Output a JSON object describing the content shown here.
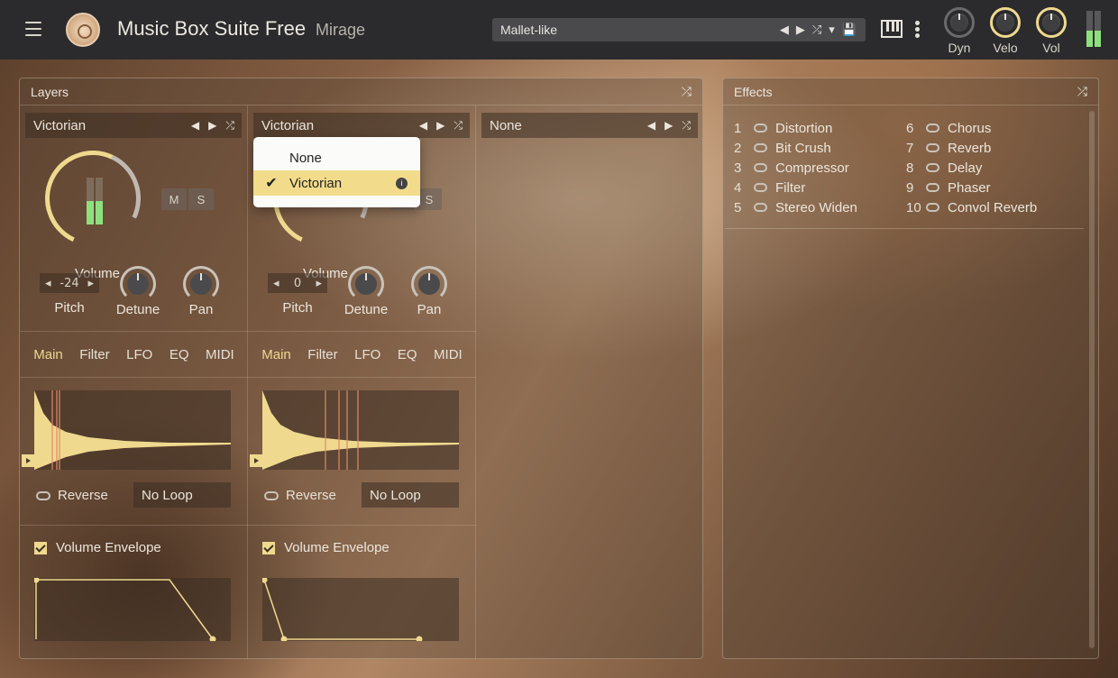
{
  "app": {
    "title": "Music Box Suite Free",
    "subtitle": "Mirage",
    "preset": "Mallet-like",
    "preset_controls": [
      "◀",
      "▶",
      "⤮",
      "▾",
      "💾"
    ],
    "knobs": [
      {
        "label": "Dyn",
        "active": false
      },
      {
        "label": "Velo",
        "active": true
      },
      {
        "label": "Vol",
        "active": true
      }
    ]
  },
  "layers": {
    "title": "Layers",
    "columns": [
      {
        "source": "Victorian",
        "volume_label": "Volume",
        "ms": [
          "M",
          "S"
        ],
        "pitch_value": "-24",
        "pitch_label": "Pitch",
        "detune_label": "Detune",
        "pan_label": "Pan",
        "tabs": [
          "Main",
          "Filter",
          "LFO",
          "EQ",
          "MIDI"
        ],
        "active_tab": "Main",
        "reverse_label": "Reverse",
        "loop": "No Loop",
        "envelope_label": "Volume Envelope"
      },
      {
        "source": "Victorian",
        "volume_label": "Volume",
        "ms": [
          "M",
          "S"
        ],
        "pitch_value": "0",
        "pitch_label": "Pitch",
        "detune_label": "Detune",
        "pan_label": "Pan",
        "tabs": [
          "Main",
          "Filter",
          "LFO",
          "EQ",
          "MIDI"
        ],
        "active_tab": "Main",
        "reverse_label": "Reverse",
        "loop": "No Loop",
        "envelope_label": "Volume Envelope"
      },
      {
        "source": "None"
      }
    ],
    "dropdown": {
      "items": [
        "None",
        "Victorian"
      ],
      "selected": "Victorian"
    }
  },
  "effects": {
    "title": "Effects",
    "items": [
      {
        "num": "1",
        "name": "Distortion"
      },
      {
        "num": "2",
        "name": "Bit Crush"
      },
      {
        "num": "3",
        "name": "Compressor"
      },
      {
        "num": "4",
        "name": "Filter"
      },
      {
        "num": "5",
        "name": "Stereo Widen"
      },
      {
        "num": "6",
        "name": "Chorus"
      },
      {
        "num": "7",
        "name": "Reverb"
      },
      {
        "num": "8",
        "name": "Delay"
      },
      {
        "num": "9",
        "name": "Phaser"
      },
      {
        "num": "10",
        "name": "Convol Reverb"
      }
    ]
  },
  "colors": {
    "accent": "#efd98e",
    "meter": "#8ee07f",
    "topbar": "#2b2b2d"
  }
}
